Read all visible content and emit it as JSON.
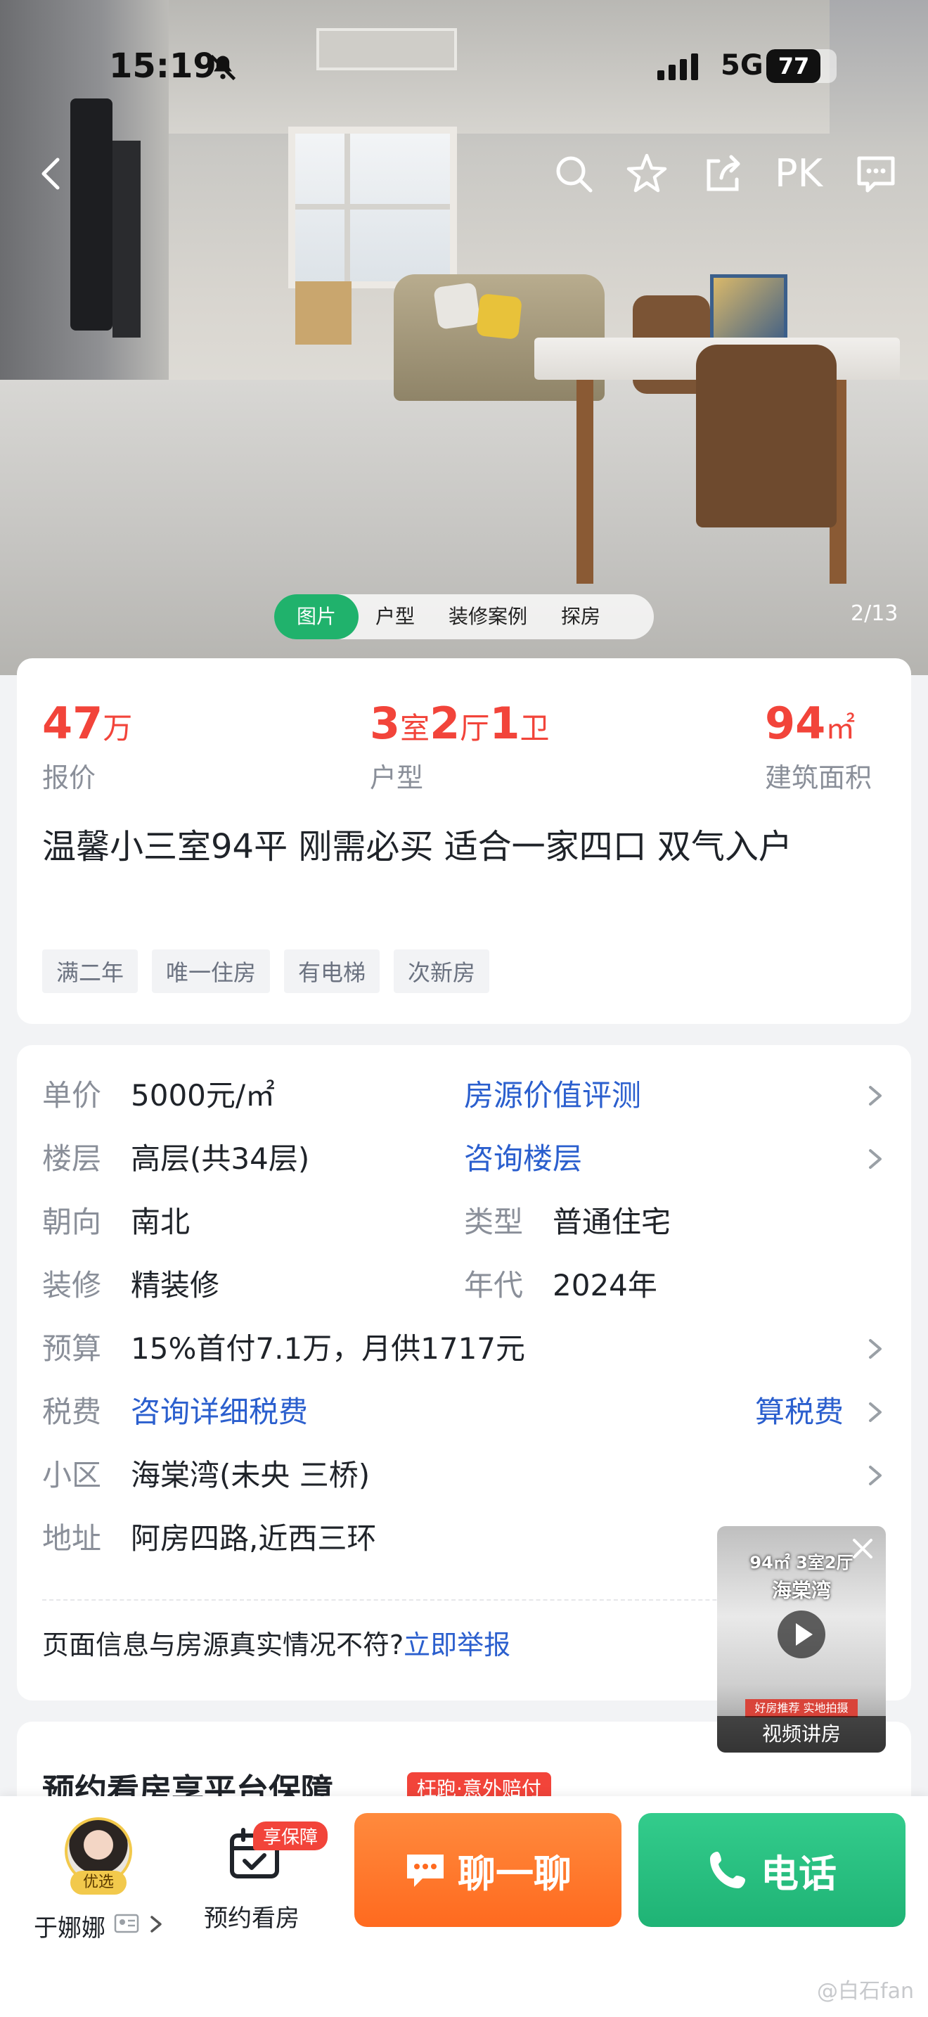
{
  "status_bar": {
    "time": "15:19",
    "network": "5G",
    "battery": "77",
    "battery_fraction": 0.77
  },
  "top_nav": {
    "pk_label": "PK"
  },
  "media": {
    "tabs": [
      "图片",
      "户型",
      "装修案例",
      "探房"
    ],
    "active_tab": 0,
    "counter": "2/13"
  },
  "summary": {
    "price": {
      "num": "47",
      "unit": "万",
      "label": "报价"
    },
    "layout": {
      "n1": "3",
      "u1": "室",
      "n2": "2",
      "u2": "厅",
      "n3": "1",
      "u3": "卫",
      "label": "户型"
    },
    "area": {
      "num": "94",
      "unit": "㎡",
      "label": "建筑面积"
    },
    "title": "温馨小三室94平 刚需必买 适合一家四口 双气入户",
    "tags": [
      "满二年",
      "唯一住房",
      "有电梯",
      "次新房"
    ]
  },
  "details": {
    "unit_price": {
      "key": "单价",
      "value": "5000元/㎡",
      "link": "房源价值评测"
    },
    "floor": {
      "key": "楼层",
      "value": "高层(共34层)",
      "link": "咨询楼层"
    },
    "orientation": {
      "key": "朝向",
      "value": "南北"
    },
    "type": {
      "key": "类型",
      "value": "普通住宅"
    },
    "decoration": {
      "key": "装修",
      "value": "精装修"
    },
    "year": {
      "key": "年代",
      "value": "2024年"
    },
    "budget": {
      "key": "预算",
      "value": "15%首付7.1万，月供1717元"
    },
    "tax": {
      "key": "税费",
      "value": "咨询详细税费",
      "link": "算税费"
    },
    "community": {
      "key": "小区",
      "value": "海棠湾(未央 三桥)"
    },
    "address": {
      "key": "地址",
      "value": "阿房四路,近西三环"
    },
    "report_text": "页面信息与房源真实情况不符?",
    "report_link": "立即举报"
  },
  "video": {
    "title_line1": "94㎡ 3室2厅",
    "title_line2": "海棠湾",
    "ribbon": "好房推荐 实地拍摄",
    "label": "视频讲房"
  },
  "guarantee": {
    "heading": "预约看房享平台保障",
    "badge": "枉跑·意外赔付"
  },
  "bottom": {
    "agent_badge": "优选",
    "agent_name": "于娜娜",
    "book_badge": "享保障",
    "book_label": "预约看房",
    "chat_label": "聊一聊",
    "call_label": "电话"
  },
  "watermark": "@白石fan",
  "colors": {
    "accent_red": "#f2443a",
    "link_blue": "#2b5fce",
    "green": "#20b26c",
    "orange": "#ff7a2e"
  }
}
